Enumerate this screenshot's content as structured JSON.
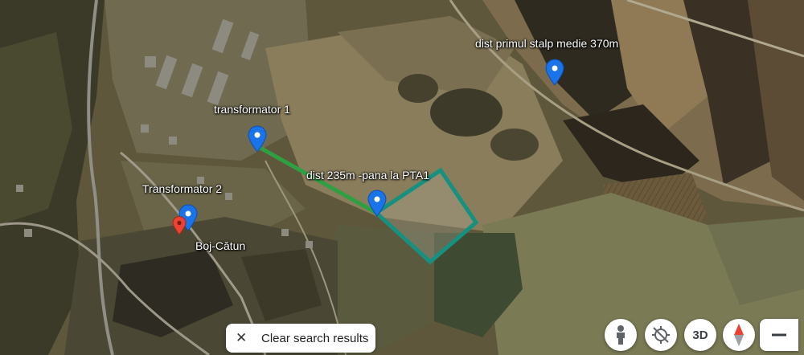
{
  "placemarks": [
    {
      "id": "transformator-1",
      "label": "transformator 1"
    },
    {
      "id": "transformator-2",
      "label": "Transformator 2"
    },
    {
      "id": "primul-stalp",
      "label": "dist primul stalp medie 370m"
    },
    {
      "id": "pta1",
      "label": "dist 235m -pana la PTA1"
    }
  ],
  "search_result": {
    "label": "Boj-Cătun"
  },
  "clear_search": {
    "label": "Clear search results",
    "icon": "close-icon"
  },
  "controls": {
    "pegman_icon": "pegman-icon",
    "location_icon": "location-off-icon",
    "three_d_label": "3D",
    "compass_icon": "compass-icon",
    "zoom_out_icon": "minus-icon"
  },
  "colors": {
    "pin": "#1a73e8",
    "search_pin": "#ea4335",
    "distance_line": "#2ea043",
    "polygon": "#16917f"
  }
}
